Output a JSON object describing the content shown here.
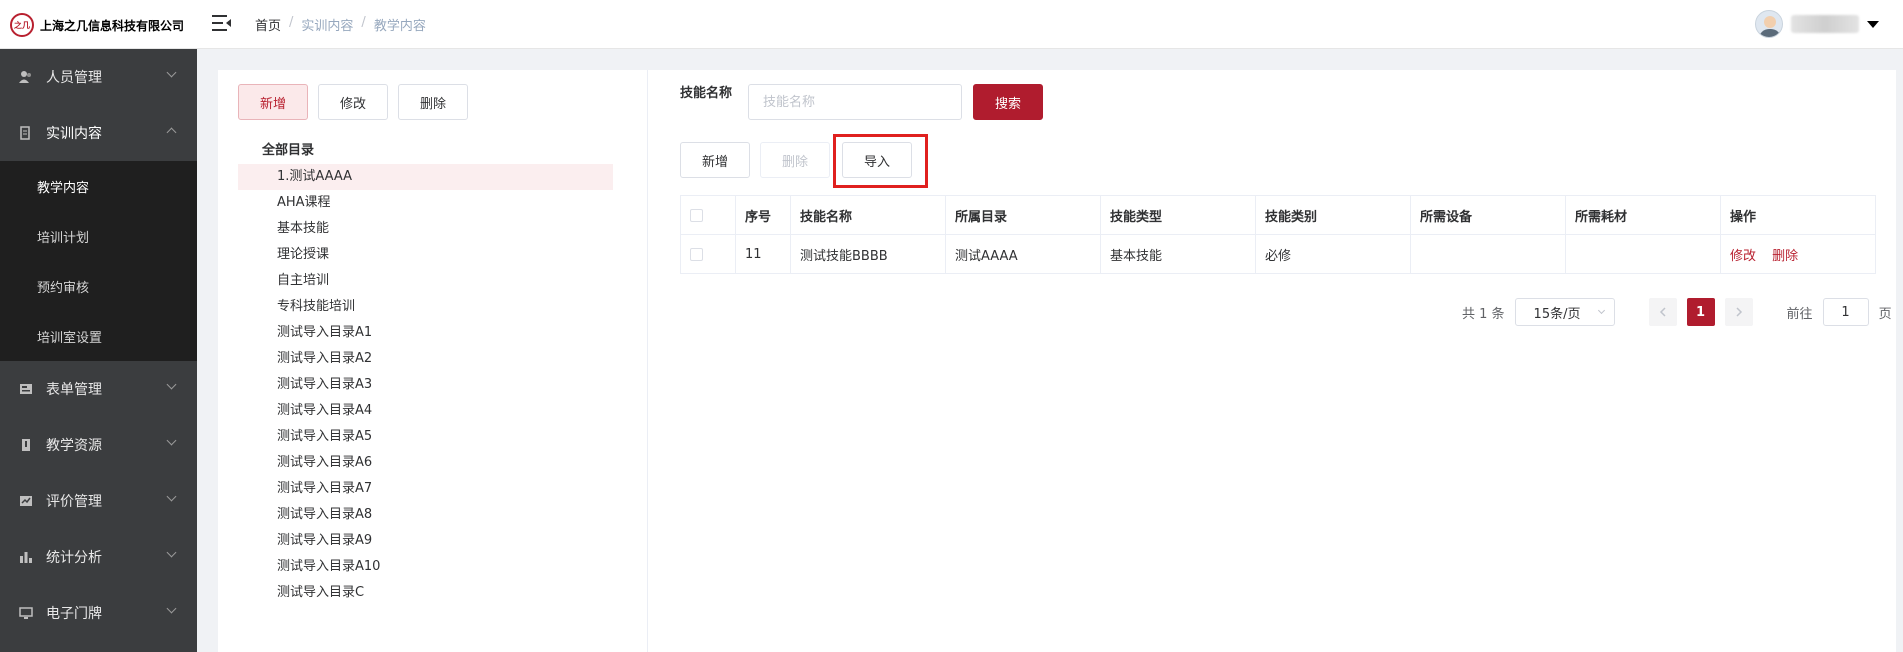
{
  "header": {
    "company": "上海之几信息科技有限公司",
    "logo_text": "之几",
    "breadcrumb": [
      "首页",
      "实训内容",
      "教学内容"
    ]
  },
  "sidebar": {
    "items": [
      {
        "label": "人员管理",
        "icon": "user-icon",
        "expanded": false
      },
      {
        "label": "实训内容",
        "icon": "book-icon",
        "expanded": true,
        "children": [
          {
            "label": "教学内容",
            "active": true
          },
          {
            "label": "培训计划"
          },
          {
            "label": "预约审核"
          },
          {
            "label": "培训室设置"
          }
        ]
      },
      {
        "label": "表单管理",
        "icon": "form-icon",
        "expanded": false
      },
      {
        "label": "教学资源",
        "icon": "resource-icon",
        "expanded": false
      },
      {
        "label": "评价管理",
        "icon": "evaluation-icon",
        "expanded": false
      },
      {
        "label": "统计分析",
        "icon": "bar-chart-icon",
        "expanded": false
      },
      {
        "label": "电子门牌",
        "icon": "monitor-icon",
        "expanded": false
      }
    ]
  },
  "left_panel": {
    "buttons": {
      "add": "新增",
      "edit": "修改",
      "delete": "删除"
    },
    "tree": {
      "root": "全部目录",
      "nodes": [
        "1.测试AAAA",
        "AHA课程",
        "基本技能",
        "理论授课",
        "自主培训",
        "专科技能培训",
        "测试导入目录A1",
        "测试导入目录A2",
        "测试导入目录A3",
        "测试导入目录A4",
        "测试导入目录A5",
        "测试导入目录A6",
        "测试导入目录A7",
        "测试导入目录A8",
        "测试导入目录A9",
        "测试导入目录A10",
        "测试导入目录C"
      ],
      "selected_index": 0
    }
  },
  "right_panel": {
    "search": {
      "label": "技能名称",
      "placeholder": "技能名称",
      "value": "",
      "button": "搜索"
    },
    "toolbar": {
      "add": "新增",
      "delete": "删除",
      "import": "导入"
    },
    "table": {
      "columns": [
        "序号",
        "技能名称",
        "所属目录",
        "技能类型",
        "技能类别",
        "所需设备",
        "所需耗材",
        "操作"
      ],
      "rows": [
        {
          "index": "11",
          "name": "测试技能BBBB",
          "catalog": "测试AAAA",
          "type": "基本技能",
          "category": "必修",
          "equipment": "",
          "consumables": "",
          "actions": [
            "修改",
            "删除"
          ]
        }
      ]
    },
    "pagination": {
      "total_text": "共 1 条",
      "page_size": "15条/页",
      "current_page": "1",
      "goto_label": "前往",
      "goto_value": "1",
      "page_suffix": "页"
    }
  },
  "colors": {
    "primary": "#b01c2e",
    "sidebar_bg": "#3b3d3f",
    "submenu_bg": "#1f1f1f",
    "highlight": "#e0201f"
  }
}
